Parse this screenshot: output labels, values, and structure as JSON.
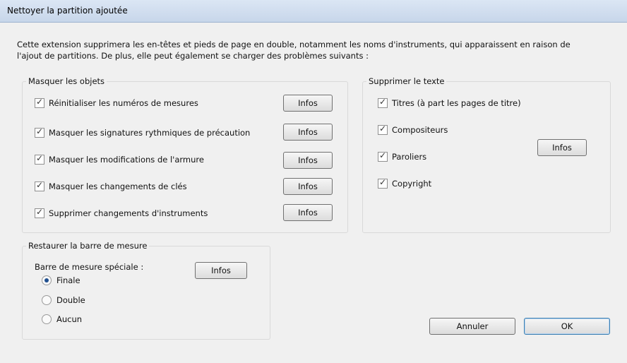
{
  "window": {
    "title": "Nettoyer la partition ajoutée"
  },
  "intro_text": "Cette extension supprimera les en-têtes et pieds de page en double, notamment les noms d'instruments, qui apparaissent en raison de l'ajout de partitions. De plus, elle peut également se charger des problèmes suivants :",
  "hide_objects": {
    "title": "Masquer les objets",
    "items": [
      {
        "label": "Réinitialiser les numéros de mesures",
        "checked": true,
        "info": "Infos"
      },
      {
        "label": "Masquer les signatures rythmiques de précaution",
        "checked": true,
        "info": "Infos"
      },
      {
        "label": "Masquer les modifications de l'armure",
        "checked": true,
        "info": "Infos"
      },
      {
        "label": "Masquer les changements de clés",
        "checked": true,
        "info": "Infos"
      },
      {
        "label": "Supprimer changements d'instruments",
        "checked": true,
        "info": "Infos"
      }
    ]
  },
  "delete_text": {
    "title": "Supprimer le texte",
    "items": [
      {
        "label": "Titres (à part les pages de titre)",
        "checked": true
      },
      {
        "label": "Compositeurs",
        "checked": true
      },
      {
        "label": "Paroliers",
        "checked": true
      },
      {
        "label": "Copyright",
        "checked": true
      }
    ],
    "info": "Infos"
  },
  "barline": {
    "title": "Restaurer la barre de mesure",
    "label": "Barre de mesure spéciale :",
    "info": "Infos",
    "options": [
      {
        "label": "Finale",
        "selected": true
      },
      {
        "label": "Double",
        "selected": false
      },
      {
        "label": "Aucun",
        "selected": false
      }
    ]
  },
  "actions": {
    "cancel": "Annuler",
    "ok": "OK"
  }
}
